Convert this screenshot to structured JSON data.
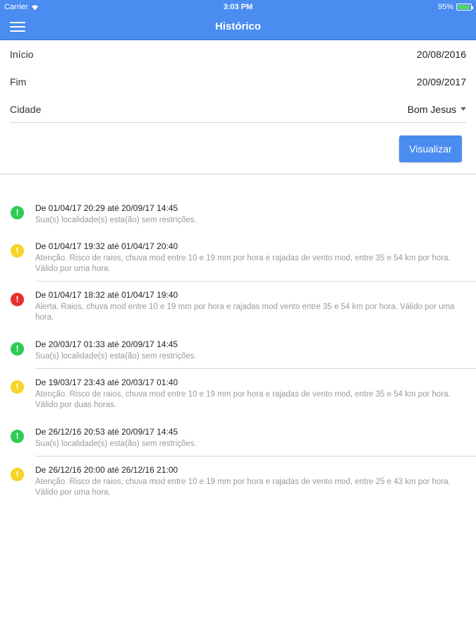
{
  "status_bar": {
    "carrier": "Carrier",
    "time": "3:03 PM",
    "battery": "95%",
    "battery_level": 0.95,
    "wifi_icon": "wifi-icon"
  },
  "nav": {
    "title": "Histórico",
    "menu_icon": "hamburger-menu-icon"
  },
  "form": {
    "inicio_label": "Início",
    "inicio_value": "20/08/2016",
    "fim_label": "Fim",
    "fim_value": "20/09/2017",
    "cidade_label": "Cidade",
    "cidade_value": "Bom Jesus"
  },
  "button": {
    "visualizar": "Visualizar"
  },
  "colors": {
    "accent": "#4a8cf0",
    "green": "#2ecc55",
    "yellow": "#f5d327",
    "red": "#e8302f"
  },
  "history": [
    {
      "status": "green",
      "icon": "!",
      "title": "De 01/04/17 20:29 até 20/09/17 14:45",
      "desc": "Sua(s) localidade(s) esta(ão) sem restrições."
    },
    {
      "status": "yellow",
      "icon": "!",
      "title": "De 01/04/17 19:32 até 01/04/17 20:40",
      "desc": "Atenção. Risco de raios, chuva mod entre 10 e 19 mm por hora e rajadas de vento mod, entre 35 e 54 km por hora. Válido por uma hora."
    },
    {
      "status": "red",
      "icon": "!",
      "title": "De 01/04/17 18:32 até 01/04/17 19:40",
      "desc": "Alerta. Raios, chuva mod entre 10 e 19 mm por hora e rajadas mod vento entre 35 e 54 km por hora. Válido por uma hora."
    },
    {
      "status": "green",
      "icon": "!",
      "title": "De 20/03/17 01:33 até 20/09/17 14:45",
      "desc": "Sua(s) localidade(s) esta(ão) sem restrições."
    },
    {
      "status": "yellow",
      "icon": "!",
      "title": "De 19/03/17 23:43 até 20/03/17 01:40",
      "desc": "Atenção. Risco de raios, chuva mod entre 10 e 19 mm por hora e rajadas de vento mod, entre 35 e 54 km por hora. Válido por duas horas."
    },
    {
      "status": "green",
      "icon": "!",
      "title": "De 26/12/16 20:53 até 20/09/17 14:45",
      "desc": "Sua(s) localidade(s) esta(ão) sem restrições."
    },
    {
      "status": "yellow",
      "icon": "!",
      "title": "De 26/12/16 20:00 até 26/12/16 21:00",
      "desc": "Atenção. Risco de raios, chuva mod entre 10 e 19 mm por hora e rajadas de vento mod, entre 25 e 43 km por hora. Válido por uma hora."
    }
  ]
}
